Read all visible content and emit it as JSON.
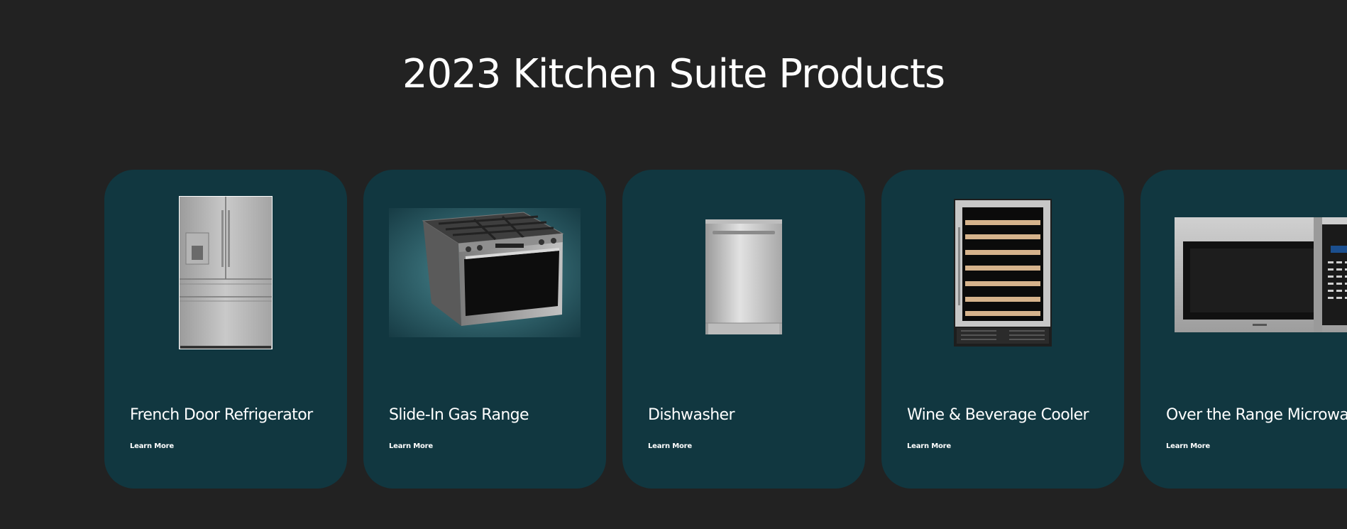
{
  "section": {
    "title": "2023 Kitchen Suite Products"
  },
  "products": [
    {
      "name": "French Door Refrigerator",
      "link": "Learn More",
      "image": "refrigerator-image"
    },
    {
      "name": "Slide-In Gas Range",
      "link": "Learn More",
      "image": "gas-range-image"
    },
    {
      "name": "Dishwasher",
      "link": "Learn More",
      "image": "dishwasher-image"
    },
    {
      "name": "Wine & Beverage Cooler",
      "link": "Learn More",
      "image": "wine-cooler-image"
    },
    {
      "name": "Over the Range Microwave",
      "link": "Learn More",
      "image": "microwave-image"
    }
  ],
  "colors": {
    "background": "#222222",
    "card": "#113740",
    "text": "#ffffff"
  }
}
